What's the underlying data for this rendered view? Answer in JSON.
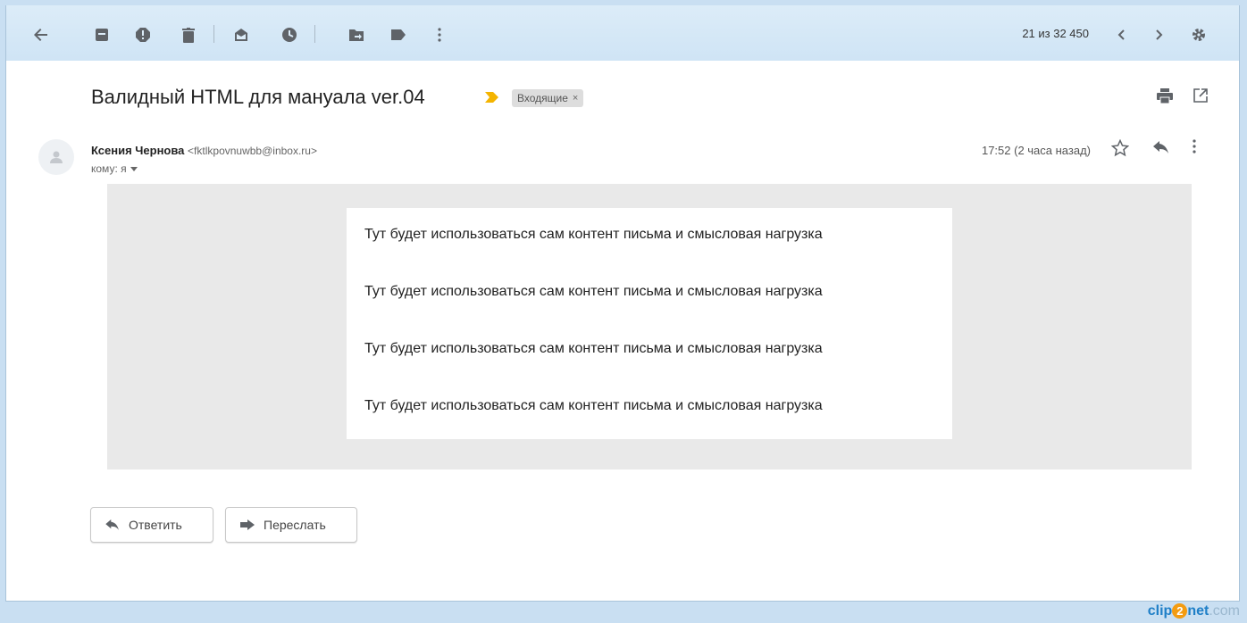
{
  "toolbar": {
    "icons": [
      "back-arrow-icon",
      "archive-icon",
      "report-spam-icon",
      "delete-icon",
      "mark-unread-icon",
      "snooze-icon",
      "move-to-icon",
      "labels-icon",
      "more-vert-icon"
    ],
    "counter": "21 из 32 450"
  },
  "message": {
    "subject": "Валидный HTML для мануала ver.04",
    "label": "Входящие",
    "label_remove": "×",
    "sender_name": "Ксения Чернова",
    "sender_email": "<fktlkpovnuwbb@inbox.ru>",
    "to": "кому: я",
    "time": "17:52 (2 часа назад)"
  },
  "body": {
    "lines": [
      "Тут будет использоваться сам контент письма и смысловая нагрузка",
      "Тут будет использоваться сам контент письма и смысловая нагрузка",
      "Тут будет использоваться сам контент письма и смысловая нагрузка",
      "Тут будет использоваться сам контент письма и смысловая нагрузка"
    ]
  },
  "actions": {
    "reply": "Ответить",
    "forward": "Переслать"
  },
  "watermark": {
    "part1": "clip",
    "part2": "2",
    "part3": "net",
    "part4": ".com"
  },
  "colors": {
    "toolbar_bg": "#d4e7f6",
    "important_marker": "#f4b400",
    "body_bg": "#e9e9e9",
    "icon": "#5f6368"
  }
}
